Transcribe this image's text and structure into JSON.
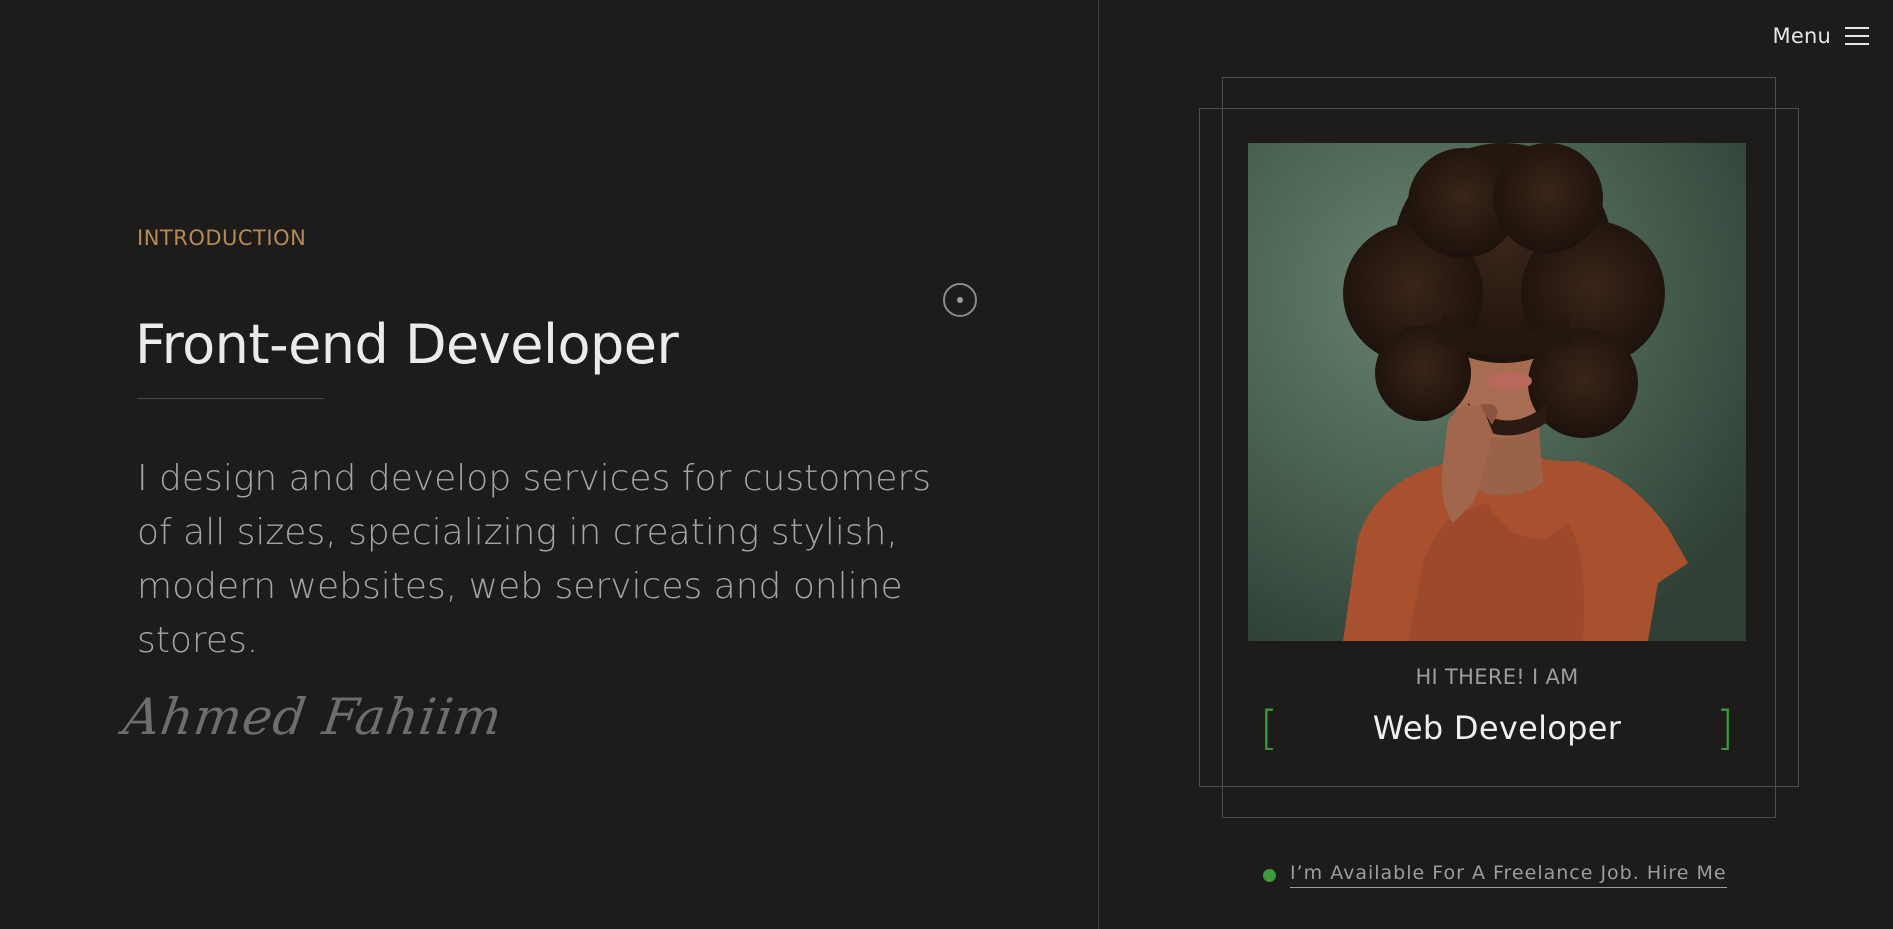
{
  "header": {
    "menu_label": "Menu",
    "menu_icon": "hamburger-icon"
  },
  "intro": {
    "eyebrow": "INTRODUCTION",
    "title": "Front-end Developer",
    "description": "I design and develop services for customers of all sizes, specializing in creating stylish, modern websites, web services and online stores.",
    "signature": "Ahmed Fahiim"
  },
  "card": {
    "greeting": "HI THERE! I AM",
    "role": "Web Developer",
    "bracket_left": "[",
    "bracket_right": "]"
  },
  "availability": {
    "text": "I’m Available For A Freelance Job. Hire Me"
  },
  "colors": {
    "background": "#1d1c1b",
    "accent_gold": "#b58a56",
    "accent_green": "#3c9a3f"
  }
}
